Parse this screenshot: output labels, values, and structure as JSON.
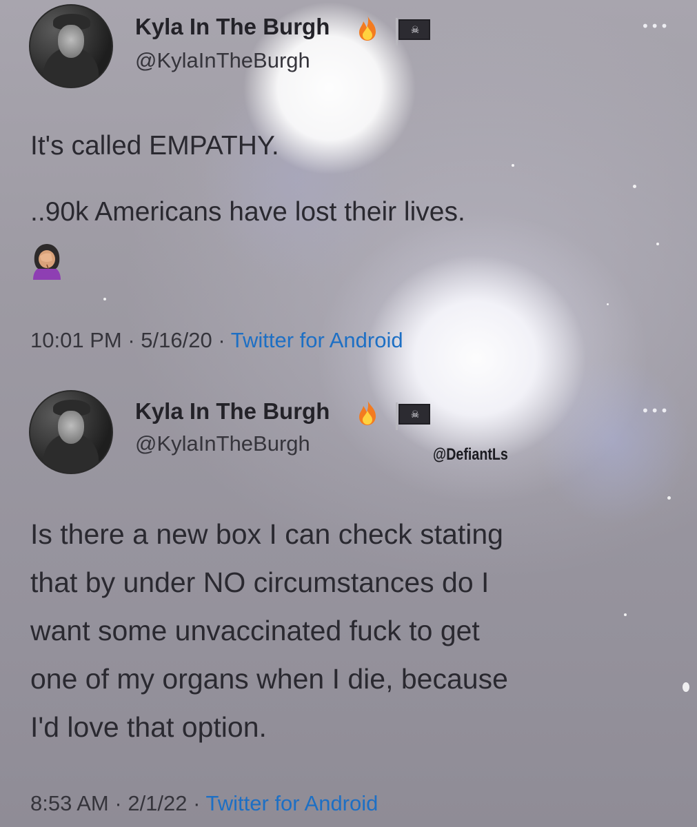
{
  "tweets": [
    {
      "author": {
        "display_name": "Kyla In The Burgh",
        "handle": "@KylaInTheBurgh",
        "badges": [
          "fire-emoji",
          "pirate-flag-emoji"
        ]
      },
      "lines": [
        "It's called EMPATHY.",
        "..90k Americans have lost their lives."
      ],
      "trailing_emoji": "face-palm-woman-emoji",
      "time": "10:01 PM",
      "date": "5/16/20",
      "source": "Twitter for Android",
      "separator": "·"
    },
    {
      "author": {
        "display_name": "Kyla In The Burgh",
        "handle": "@KylaInTheBurgh",
        "badges": [
          "fire-emoji",
          "pirate-flag-emoji"
        ]
      },
      "lines": [
        "Is there a new box I can check stating",
        "that by under NO circumstances do I",
        "want some unvaccinated fuck to get",
        "one of my organs when I die, because",
        "I'd love that option."
      ],
      "time": "8:53 AM",
      "date": "2/1/22",
      "source": "Twitter for Android",
      "separator": "·"
    }
  ],
  "more_menu_glyph": "•••",
  "watermark": "@DefiantLs",
  "colors": {
    "text": "#2a2930",
    "meta": "#35343b",
    "link": "#1d6fc4",
    "background": "#9c9aa4"
  }
}
